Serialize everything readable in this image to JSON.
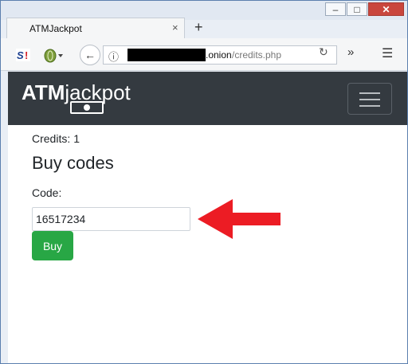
{
  "window": {
    "minimize_symbol": "–",
    "maximize_symbol": "□",
    "close_symbol": "✕"
  },
  "tab": {
    "title": "ATMJackpot",
    "close_symbol": "×",
    "new_tab_symbol": "+"
  },
  "toolbar": {
    "back_symbol": "←",
    "info_symbol": "ⓘ",
    "url_domain": ".onion",
    "url_path": "/credits.php",
    "reload_symbol": "↻",
    "overflow_symbol": "»",
    "menu_symbol": "☰",
    "icons": [
      "shield-extension-icon",
      "tor-onion-icon",
      "back-arrow-icon",
      "info-icon",
      "reload-icon",
      "overflow-chevron-icon",
      "hamburger-menu-icon"
    ]
  },
  "site": {
    "brand_bold": "ATM",
    "brand_light": "jackpot",
    "nav_bg": "#343a40"
  },
  "page": {
    "credits_label": "Credits:",
    "credits_value": "1",
    "heading": "Buy codes",
    "code_label": "Code:",
    "code_value": "16517234",
    "buy_label": "Buy",
    "buy_color": "#28a745",
    "arrow_color": "#ec1c24"
  }
}
